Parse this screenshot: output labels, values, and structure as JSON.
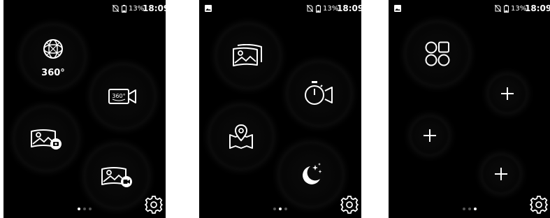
{
  "screens": [
    {
      "status": {
        "battery_pct": "13%",
        "time": "18:09"
      },
      "buttons": [
        {
          "name": "360-photo",
          "label": "360°"
        },
        {
          "name": "360-video"
        },
        {
          "name": "panorama-photo"
        },
        {
          "name": "panorama-video"
        }
      ],
      "pager": {
        "count": 3,
        "active": 0
      }
    },
    {
      "status": {
        "battery_pct": "13%",
        "time": "18:09"
      },
      "buttons": [
        {
          "name": "panorama-gallery"
        },
        {
          "name": "timelapse-video"
        },
        {
          "name": "map-location"
        },
        {
          "name": "night-mode"
        }
      ],
      "pager": {
        "count": 3,
        "active": 1
      }
    },
    {
      "status": {
        "battery_pct": "13%",
        "time": "18:09"
      },
      "buttons": [
        {
          "name": "apps-grid"
        },
        {
          "name": "add-slot"
        },
        {
          "name": "add-slot"
        },
        {
          "name": "add-slot"
        }
      ],
      "pager": {
        "count": 3,
        "active": 2
      }
    }
  ],
  "icons": {
    "sim": "no-sim-icon",
    "battery": "battery-icon",
    "gallery": "image-notification-icon",
    "settings": "gear-icon"
  },
  "colors": {
    "screen_bg": "#000000",
    "icon": "#ffffff",
    "dot_inactive": "#555555",
    "dot_active": "#ffffff"
  }
}
